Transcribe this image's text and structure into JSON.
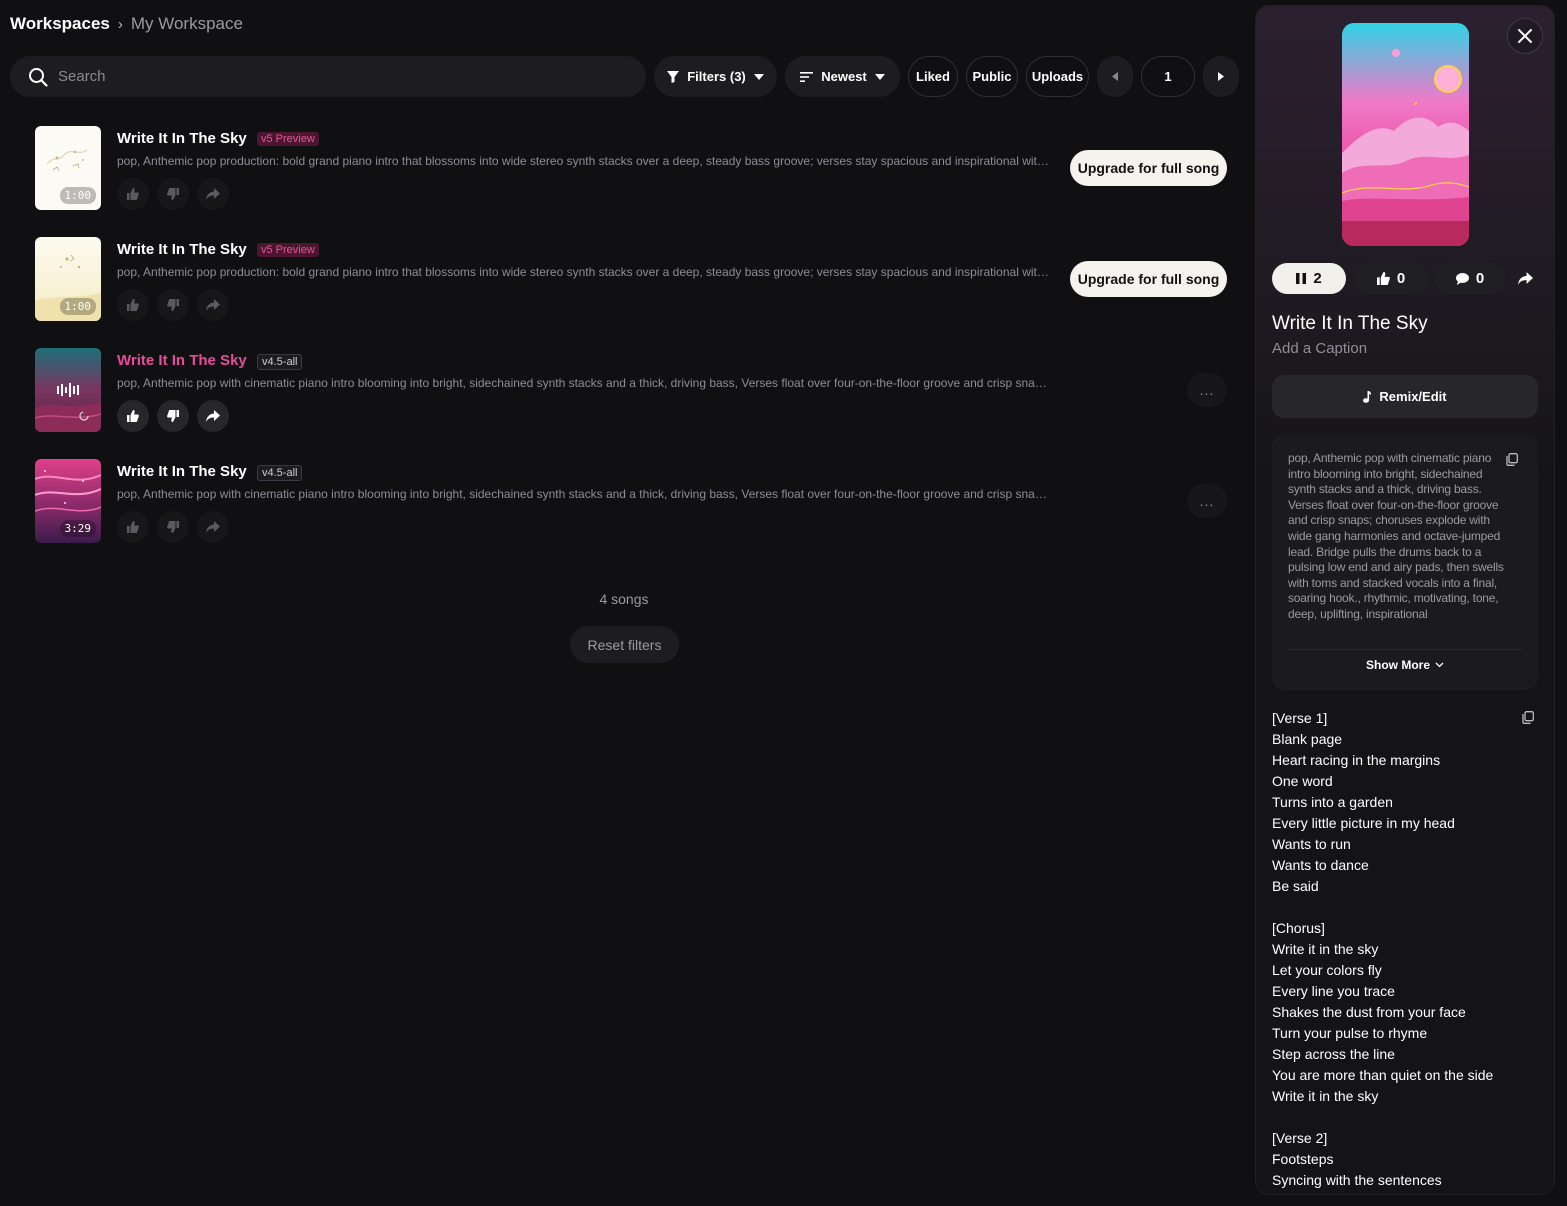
{
  "breadcrumb": {
    "root": "Workspaces",
    "current": "My Workspace"
  },
  "toolbar": {
    "search_placeholder": "Search",
    "filters_label": "Filters (3)",
    "sort_label": "Newest",
    "liked_label": "Liked",
    "public_label": "Public",
    "uploads_label": "Uploads",
    "page_number": "1"
  },
  "songs": [
    {
      "title": "Write It In The Sky",
      "version": "v5 Preview",
      "description": "pop, Anthemic pop production: bold grand piano intro that blossoms into wide stereo synth stacks over a deep, steady bass groove; verses stay spacious and inspirational with light pe...",
      "duration": "1:00",
      "action": "Upgrade for full song"
    },
    {
      "title": "Write It In The Sky",
      "version": "v5 Preview",
      "description": "pop, Anthemic pop production: bold grand piano intro that blossoms into wide stereo synth stacks over a deep, steady bass groove; verses stay spacious and inspirational with light pe...",
      "duration": "1:00",
      "action": "Upgrade for full song"
    },
    {
      "title": "Write It In The Sky",
      "version": "v4.5-all",
      "description": "pop, Anthemic pop with cinematic piano intro blooming into bright, sidechained synth stacks and a thick, driving bass, Verses float over four-on-the-floor groove and crisp snaps; ch...",
      "duration": "",
      "action": "..."
    },
    {
      "title": "Write It In The Sky",
      "version": "v4.5-all",
      "description": "pop, Anthemic pop with cinematic piano intro blooming into bright, sidechained synth stacks and a thick, driving bass, Verses float over four-on-the-floor groove and crisp snaps; ch...",
      "duration": "3:29",
      "action": "..."
    }
  ],
  "list_footer": {
    "count": "4 songs",
    "reset_label": "Reset filters"
  },
  "panel": {
    "play_count": "2",
    "like_count": "0",
    "comment_count": "0",
    "title": "Write It In The Sky",
    "caption": "Add a Caption",
    "remix_label": "Remix/Edit",
    "style_text": "pop, Anthemic pop with cinematic piano intro blooming into bright, sidechained synth stacks and a thick, driving bass. Verses float over four-on-the-floor groove and crisp snaps; choruses explode with wide gang harmonies and octave-jumped lead. Bridge pulls the drums back to a pulsing low end and airy pads, then swells with toms and stacked vocals into a final, soaring hook., rhythmic, motivating, tone, deep, uplifting, inspirational",
    "show_more_label": "Show More",
    "lyrics": [
      "[Verse 1]",
      "Blank page",
      "Heart racing in the margins",
      "One word",
      "Turns into a garden",
      "Every little picture in my head",
      "Wants to run",
      "Wants to dance",
      "Be said",
      "",
      "[Chorus]",
      "Write it in the sky",
      "Let your colors fly",
      "Every line you trace",
      "Shakes the dust from your face",
      "Turn your pulse to rhyme",
      "Step across the line",
      "You are more than quiet on the side",
      "Write it in the sky",
      "",
      "[Verse 2]",
      "Footsteps",
      "Syncing with the sentences"
    ]
  },
  "colors": {
    "accent_pink": "#e94b9b",
    "background": "#101012",
    "surface": "#1d1d21"
  }
}
